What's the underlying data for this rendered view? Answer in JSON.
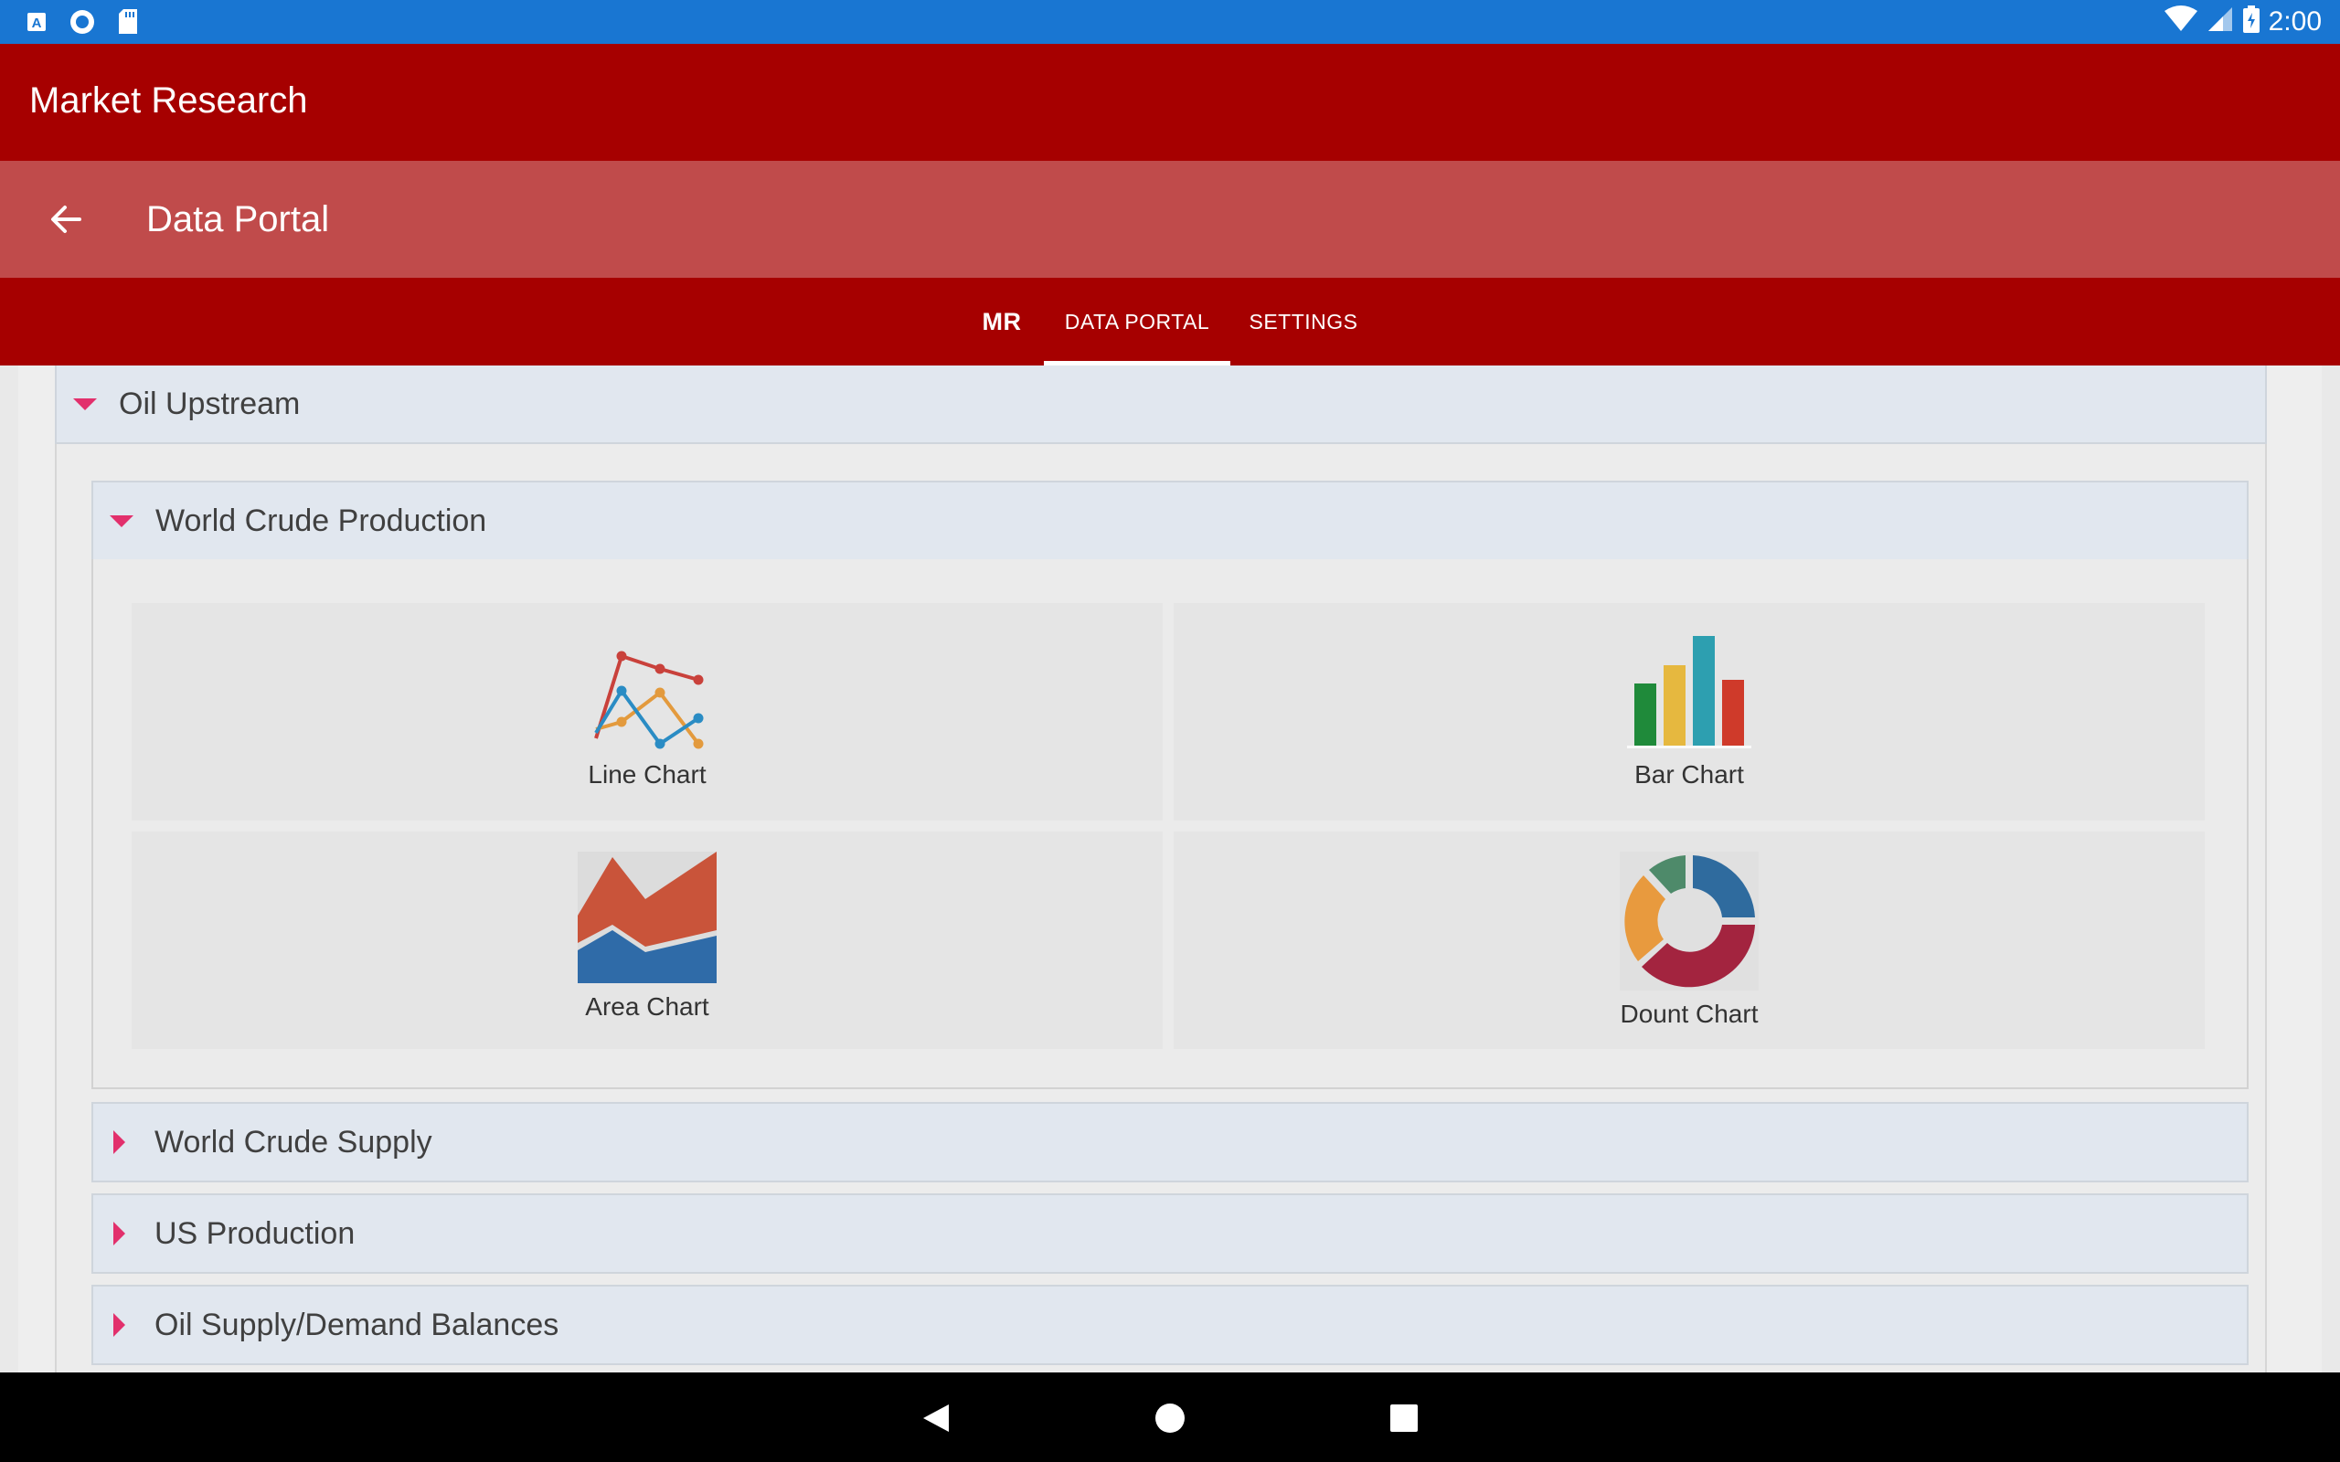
{
  "status_bar": {
    "time": "2:00",
    "left_icons": [
      "a-icon",
      "circle-icon",
      "sdcard-icon"
    ],
    "right_icons": [
      "wifi-icon",
      "signal-icon",
      "battery-icon"
    ]
  },
  "app_bar": {
    "title": "Market Research"
  },
  "sub_bar": {
    "title": "Data Portal"
  },
  "tabs": [
    {
      "label": "MR"
    },
    {
      "label": "DATA PORTAL",
      "selected": true
    },
    {
      "label": "SETTINGS"
    }
  ],
  "content": {
    "section": {
      "title": "Oil Upstream",
      "expanded": true,
      "groups": [
        {
          "title": "World Crude Production",
          "expanded": true,
          "charts": [
            {
              "label": "Line Chart",
              "icon": "line-chart-icon"
            },
            {
              "label": "Bar Chart",
              "icon": "bar-chart-icon"
            },
            {
              "label": "Area Chart",
              "icon": "area-chart-icon"
            },
            {
              "label": "Dount Chart",
              "icon": "donut-chart-icon"
            }
          ]
        },
        {
          "title": "World Crude Supply",
          "expanded": false
        },
        {
          "title": "US Production",
          "expanded": false
        },
        {
          "title": "Oil Supply/Demand Balances",
          "expanded": false
        }
      ]
    }
  },
  "colors": {
    "status_bar": "#1976d2",
    "app_bar": "#a60000",
    "sub_bar": "#c04b4b",
    "caret": "#e2306c",
    "header_bg": "#e1e7ef"
  },
  "nav_bar": {
    "buttons": [
      "back-icon",
      "home-icon",
      "recents-icon"
    ]
  }
}
